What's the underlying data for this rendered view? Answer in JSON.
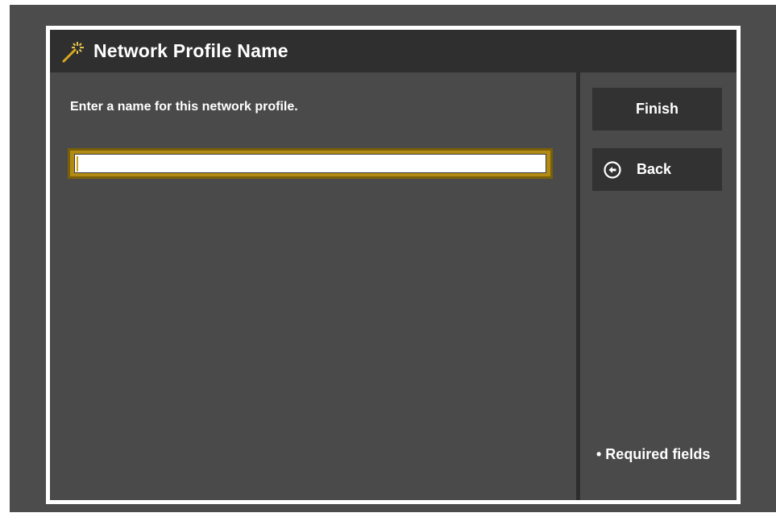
{
  "dialog": {
    "title": "Network Profile Name",
    "title_icon": "magic-wand-icon"
  },
  "form": {
    "prompt": "Enter a name for this network profile.",
    "profile_name_value": "",
    "profile_name_placeholder": ""
  },
  "actions": {
    "finish_label": "Finish",
    "back_label": "Back",
    "back_icon": "circle-arrow-left-icon"
  },
  "footer": {
    "required_note": "• Required fields"
  },
  "colors": {
    "background": "#4c4c4c",
    "titlebar": "#2f2f2f",
    "button": "#323232",
    "accent_gold": "#b18b13",
    "text": "#ffffff"
  }
}
